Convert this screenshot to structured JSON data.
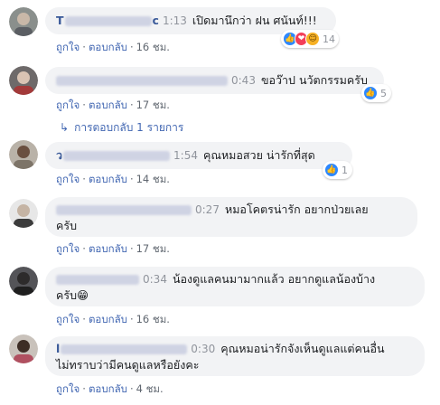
{
  "comments": [
    {
      "name": "T",
      "name_suffix": "c",
      "time": "1:13",
      "text": "เปิดมานึกว่า ฝน ศนันท์!!!",
      "reaction_count": "14",
      "reactions": [
        "like-icon",
        "love-icon",
        "haha-icon"
      ],
      "age": "16 ชม."
    },
    {
      "name": "",
      "time": "0:43",
      "text": "ขอว๊าป นวัตกรรมครับ",
      "reaction_count": "5",
      "reactions": [
        "like-icon"
      ],
      "age": "17 ชม."
    },
    {
      "name": "ว",
      "time": "1:54",
      "text": "คุณหมอสวย น่ารักที่สุด",
      "reaction_count": "1",
      "reactions": [
        "like-icon"
      ],
      "age": "14 ชม."
    },
    {
      "name": "",
      "time": "0:27",
      "text": "หมอโคตรน่ารัก อยากป่วยเลย",
      "text2": "ครับ",
      "age": "17 ชม."
    },
    {
      "name": "",
      "time": "0:34",
      "text": "น้องดูแลคนมามากแล้ว อยากดูแลน้องบ้าง",
      "text2": "ครับ",
      "emoji": "😁",
      "age": "16 ชม."
    },
    {
      "name": "l",
      "time": "0:30",
      "text": "คุณหมอน่ารักจังเห็นดูแลแต่คนอื่น",
      "text2": "ไม่ทราบว่ามีคนดูแลหรือยังคะ",
      "age": "4 ชม."
    }
  ],
  "actions": {
    "like": "ถูกใจ",
    "reply": "ตอบกลับ",
    "separator": "·"
  },
  "replies_link": "การตอบกลับ 1 รายการ",
  "colors": {
    "link": "#4267b2",
    "bubble": "#f2f3f5",
    "timestamp": "#90949c"
  }
}
